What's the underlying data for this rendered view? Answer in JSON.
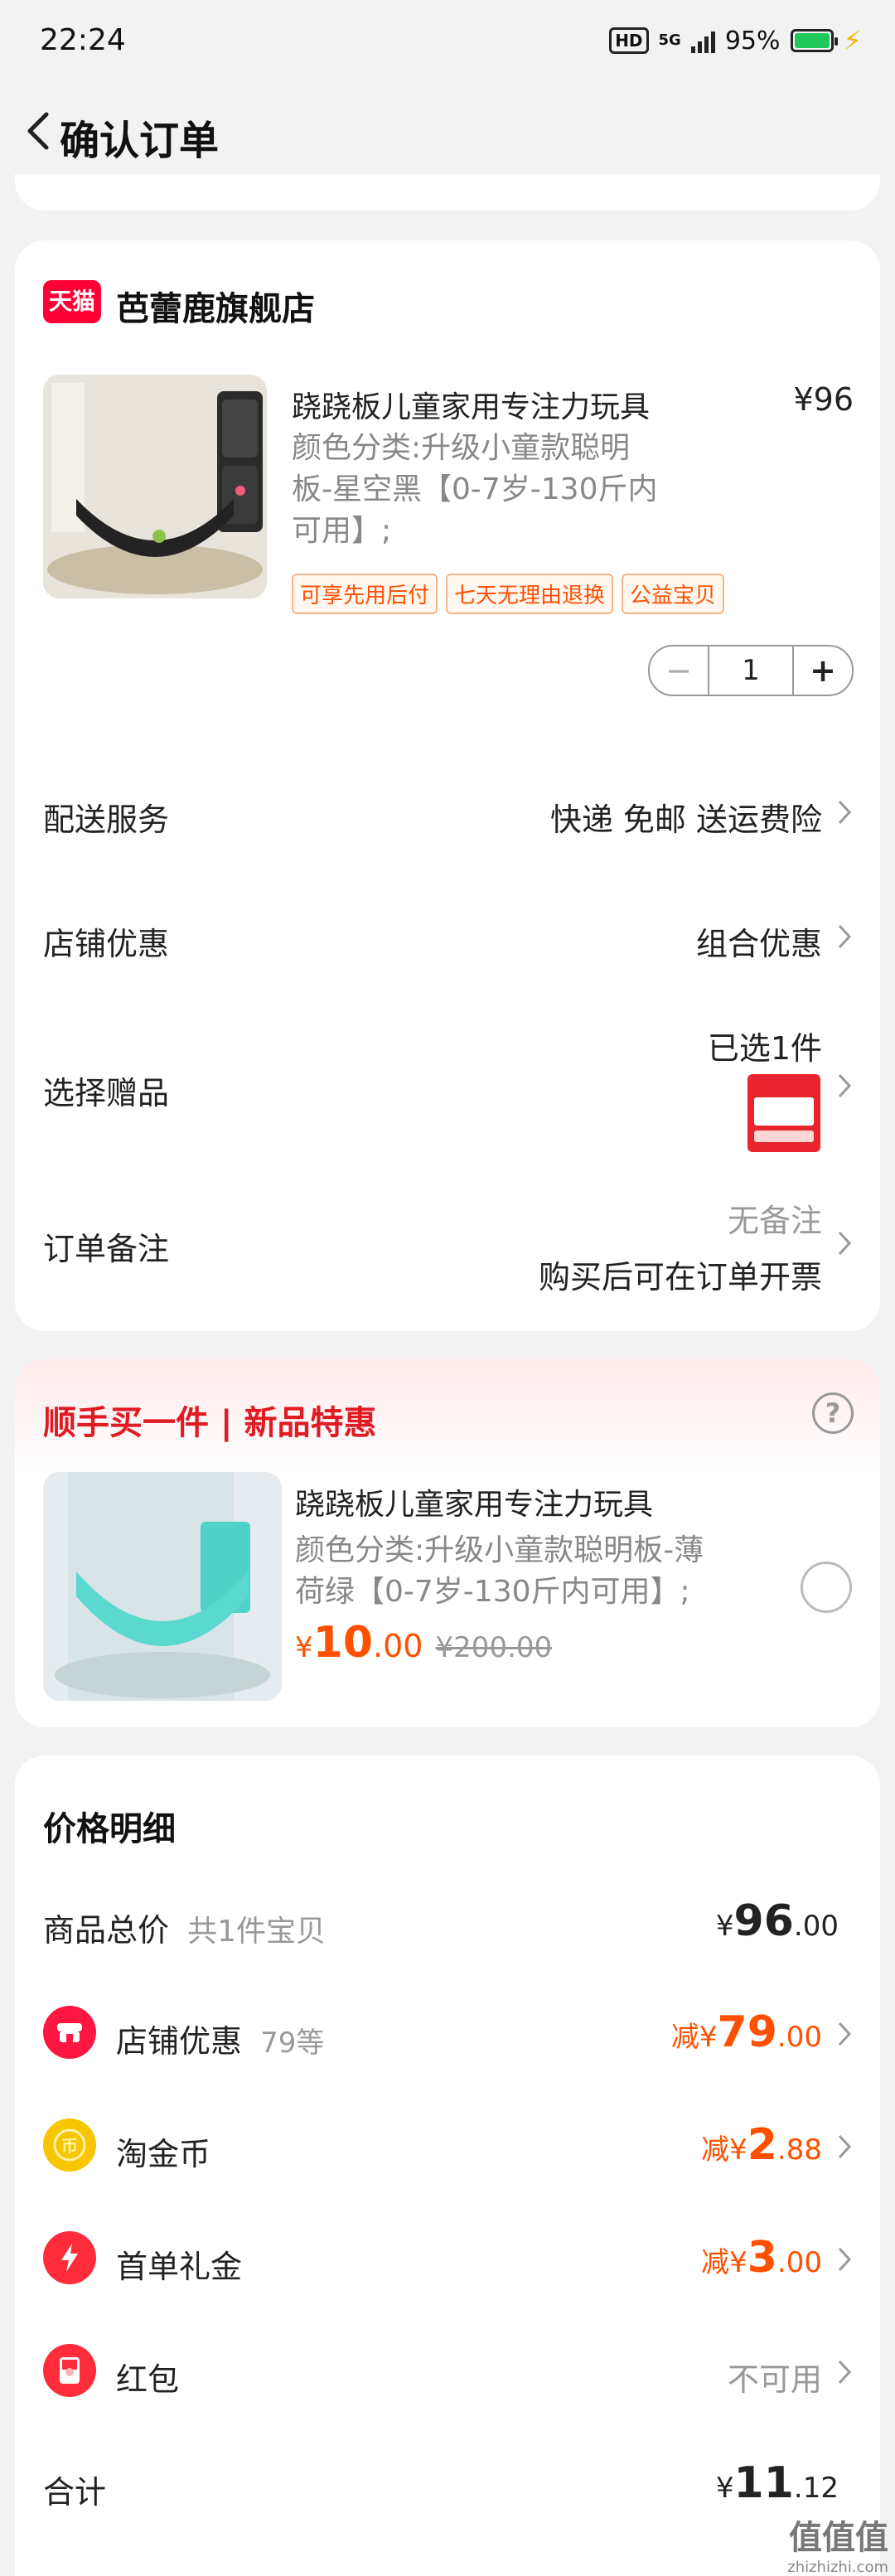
{
  "status": {
    "time": "22:24",
    "network": "5G",
    "battery": "95%"
  },
  "header": {
    "title": "确认订单"
  },
  "store": {
    "logo_text": "天猫",
    "name": "芭蕾鹿旗舰店",
    "product": {
      "title": "跷跷板儿童家用专注力玩具",
      "price": "¥96",
      "spec_line1": "颜色分类:升级小童款聪明",
      "spec_line2": "板-星空黑【0-7岁-130斤内",
      "spec_line3": "可用】;",
      "tags": [
        "可享先用后付",
        "七天无理由退换",
        "公益宝贝"
      ],
      "quantity": "1",
      "minus": "−",
      "plus": "+"
    },
    "rows": {
      "delivery_label": "配送服务",
      "delivery_value": "快递 免邮 送运费险",
      "discount_label": "店铺优惠",
      "discount_value": "组合优惠",
      "gift_label": "选择赠品",
      "gift_value": "已选1件",
      "note_label": "订单备注",
      "note_value1": "无备注",
      "note_value2": "购买后可在订单开票"
    }
  },
  "recommend": {
    "title": "顺手买一件 | 新品特惠",
    "help": "?",
    "product_title": "跷跷板儿童家用专注力玩具",
    "spec_line1": "颜色分类:升级小童款聪明板-薄",
    "spec_line2": "荷绿【0-7岁-130斤内可用】;",
    "price_symbol": "¥",
    "price_int": "10",
    "price_dec": ".00",
    "original_price": "¥200.00"
  },
  "price_detail": {
    "title": "价格明细",
    "total_label": "商品总价",
    "total_sub": "共1件宝贝",
    "total_symbol": "¥",
    "total_int": "96",
    "total_dec": ".00",
    "items": [
      {
        "label": "店铺优惠",
        "sub": "79等",
        "prefix": "减¥",
        "int": "79",
        "dec": ".00",
        "icon": "store-icon",
        "color": "#ff1744"
      },
      {
        "label": "淘金币",
        "sub": "",
        "prefix": "减¥",
        "int": "2",
        "dec": ".88",
        "icon": "coin-icon",
        "color": "#f7c600"
      },
      {
        "label": "首单礼金",
        "sub": "",
        "prefix": "减¥",
        "int": "3",
        "dec": ".00",
        "icon": "lightning-icon",
        "color": "#ff2d3b"
      },
      {
        "label": "红包",
        "sub": "",
        "value": "不可用",
        "icon": "red-packet-icon",
        "color": "#ff2d3b"
      }
    ],
    "sum_label": "合计",
    "sum_symbol": "¥",
    "sum_int": "11",
    "sum_dec": ".12"
  },
  "watermark": {
    "text": "值值值",
    "url": "zhizhizhi.com"
  }
}
